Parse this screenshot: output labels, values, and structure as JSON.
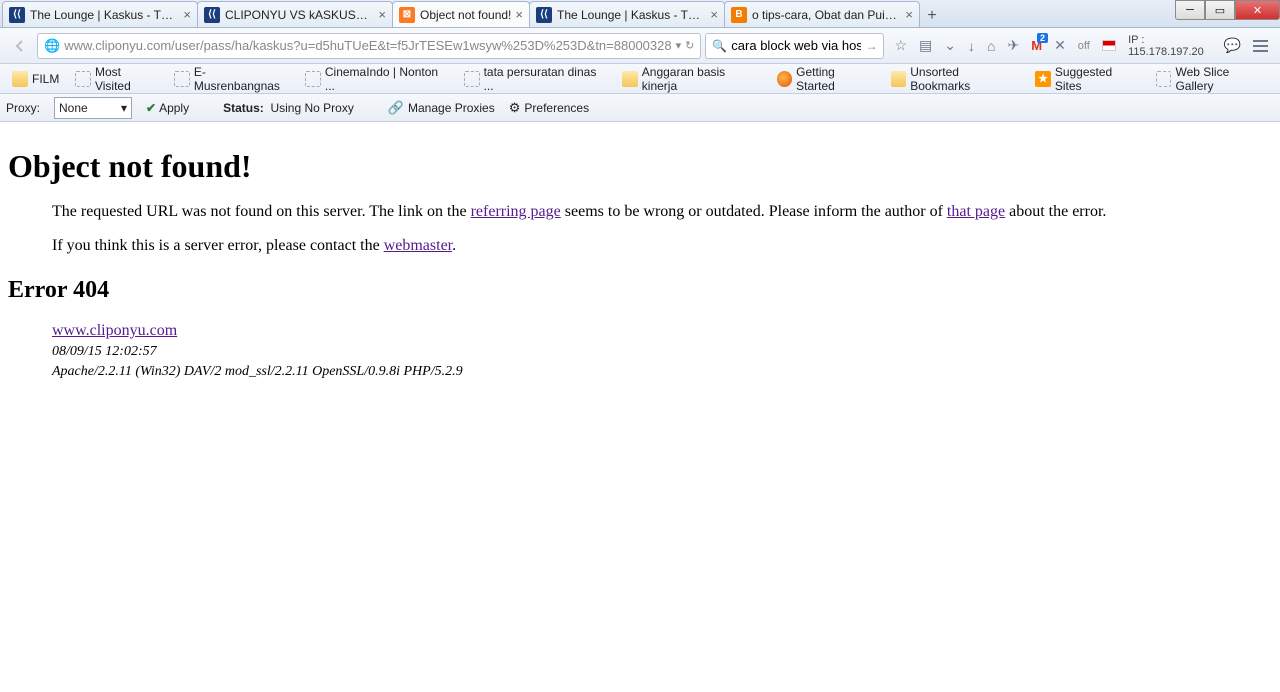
{
  "tabs": [
    {
      "title": "The Lounge | Kaskus - The ...",
      "fav": "kaskus"
    },
    {
      "title": "CLIPONYU VS kASKUSER | ...",
      "fav": "kaskus"
    },
    {
      "title": "Object not found!",
      "fav": "xampp",
      "active": true
    },
    {
      "title": "The Lounge | Kaskus - The ...",
      "fav": "kaskus"
    },
    {
      "title": "o tips-cara, Obat dan Puisi ...",
      "fav": "blogger"
    }
  ],
  "url": "www.cliponyu.com/user/pass/ha/kaskus?u=d5huTUeE&t=f5JrTESEw1wsyw%253D%253D&tn=88000328",
  "search_value": "cara block web via host",
  "gmail_badge": "2",
  "ip": {
    "off": "off",
    "addr": "IP : 115.178.197.20"
  },
  "bookmarks": [
    {
      "label": "FILM",
      "ico": "folder"
    },
    {
      "label": "Most Visited",
      "ico": "mv"
    },
    {
      "label": "E-Musrenbangnas",
      "ico": "generic"
    },
    {
      "label": "CinemaIndo | Nonton ...",
      "ico": "ci"
    },
    {
      "label": "tata persuratan dinas ...",
      "ico": "generic"
    },
    {
      "label": "Anggaran basis kinerja",
      "ico": "folder"
    },
    {
      "label": "Getting Started",
      "ico": "ff"
    },
    {
      "label": "Unsorted Bookmarks",
      "ico": "folder"
    },
    {
      "label": "Suggested Sites",
      "ico": "sugg"
    },
    {
      "label": "Web Slice Gallery",
      "ico": "generic"
    }
  ],
  "proxy": {
    "label": "Proxy:",
    "value": "None",
    "apply": "Apply",
    "status_label": "Status:",
    "status_value": "Using No Proxy",
    "manage": "Manage Proxies",
    "prefs": "Preferences"
  },
  "page": {
    "h1": "Object not found!",
    "p1a": "The requested URL was not found on this server. The link on the ",
    "p1_link1": "referring page",
    "p1b": " seems to be wrong or outdated. Please inform the author of ",
    "p1_link2": "that page",
    "p1c": " about the error.",
    "p2a": "If you think this is a server error, please contact the ",
    "p2_link": "webmaster",
    "p2b": ".",
    "h2": "Error 404",
    "host": "www.cliponyu.com",
    "date": "08/09/15 12:02:57",
    "server": "Apache/2.2.11 (Win32) DAV/2 mod_ssl/2.2.11 OpenSSL/0.9.8i PHP/5.2.9"
  }
}
